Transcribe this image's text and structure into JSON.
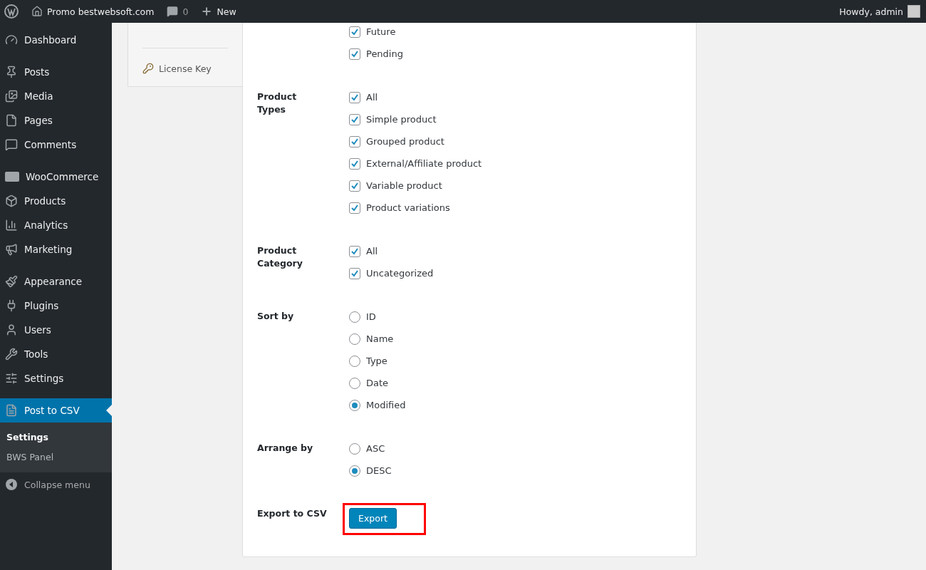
{
  "admin_bar": {
    "site": "Promo bestwebsoft.com",
    "comments": "0",
    "new": "New",
    "greeting": "Howdy, admin"
  },
  "sidebar": {
    "groups": [
      [
        {
          "label": "Dashboard",
          "selected": false
        }
      ],
      [
        {
          "label": "Posts",
          "selected": false
        },
        {
          "label": "Media",
          "selected": false
        },
        {
          "label": "Pages",
          "selected": false
        },
        {
          "label": "Comments",
          "selected": false
        }
      ],
      [
        {
          "label": "WooCommerce",
          "selected": false
        },
        {
          "label": "Products",
          "selected": false
        },
        {
          "label": "Analytics",
          "selected": false
        },
        {
          "label": "Marketing",
          "selected": false
        }
      ],
      [
        {
          "label": "Appearance",
          "selected": false
        },
        {
          "label": "Plugins",
          "selected": false
        },
        {
          "label": "Users",
          "selected": false
        },
        {
          "label": "Tools",
          "selected": false
        },
        {
          "label": "Settings",
          "selected": false
        }
      ],
      [
        {
          "label": "Post to CSV",
          "selected": true,
          "children": [
            {
              "label": "Settings",
              "selected": true
            },
            {
              "label": "BWS Panel",
              "selected": false
            }
          ]
        }
      ]
    ],
    "collapse": "Collapse menu"
  },
  "tabs": [
    {
      "label": "License Key",
      "selected": false
    }
  ],
  "form": [
    {
      "kind": "checkbox",
      "options": [
        {
          "label": "Future",
          "checked": true
        },
        {
          "label": "Pending",
          "checked": true
        }
      ]
    },
    {
      "label": "Product Types",
      "kind": "checkbox",
      "options": [
        {
          "label": "All",
          "checked": true
        },
        {
          "label": "Simple product",
          "checked": true
        },
        {
          "label": "Grouped product",
          "checked": true
        },
        {
          "label": "External/Affiliate product",
          "checked": true
        },
        {
          "label": "Variable product",
          "checked": true
        },
        {
          "label": "Product variations",
          "checked": true
        }
      ]
    },
    {
      "label": "Product Category",
      "kind": "checkbox",
      "options": [
        {
          "label": "All",
          "checked": true
        },
        {
          "label": "Uncategorized",
          "checked": true
        }
      ]
    },
    {
      "label": "Sort by",
      "kind": "radio",
      "options": [
        {
          "label": "ID",
          "selected": false
        },
        {
          "label": "Name",
          "selected": false
        },
        {
          "label": "Type",
          "selected": false
        },
        {
          "label": "Date",
          "selected": false
        },
        {
          "label": "Modified",
          "selected": true
        }
      ]
    },
    {
      "label": "Arrange by",
      "kind": "radio",
      "options": [
        {
          "label": "ASC",
          "selected": false
        },
        {
          "label": "DESC",
          "selected": true
        }
      ]
    },
    {
      "label": "Export to CSV",
      "kind": "button",
      "button": "Export",
      "highlighted": true
    }
  ]
}
